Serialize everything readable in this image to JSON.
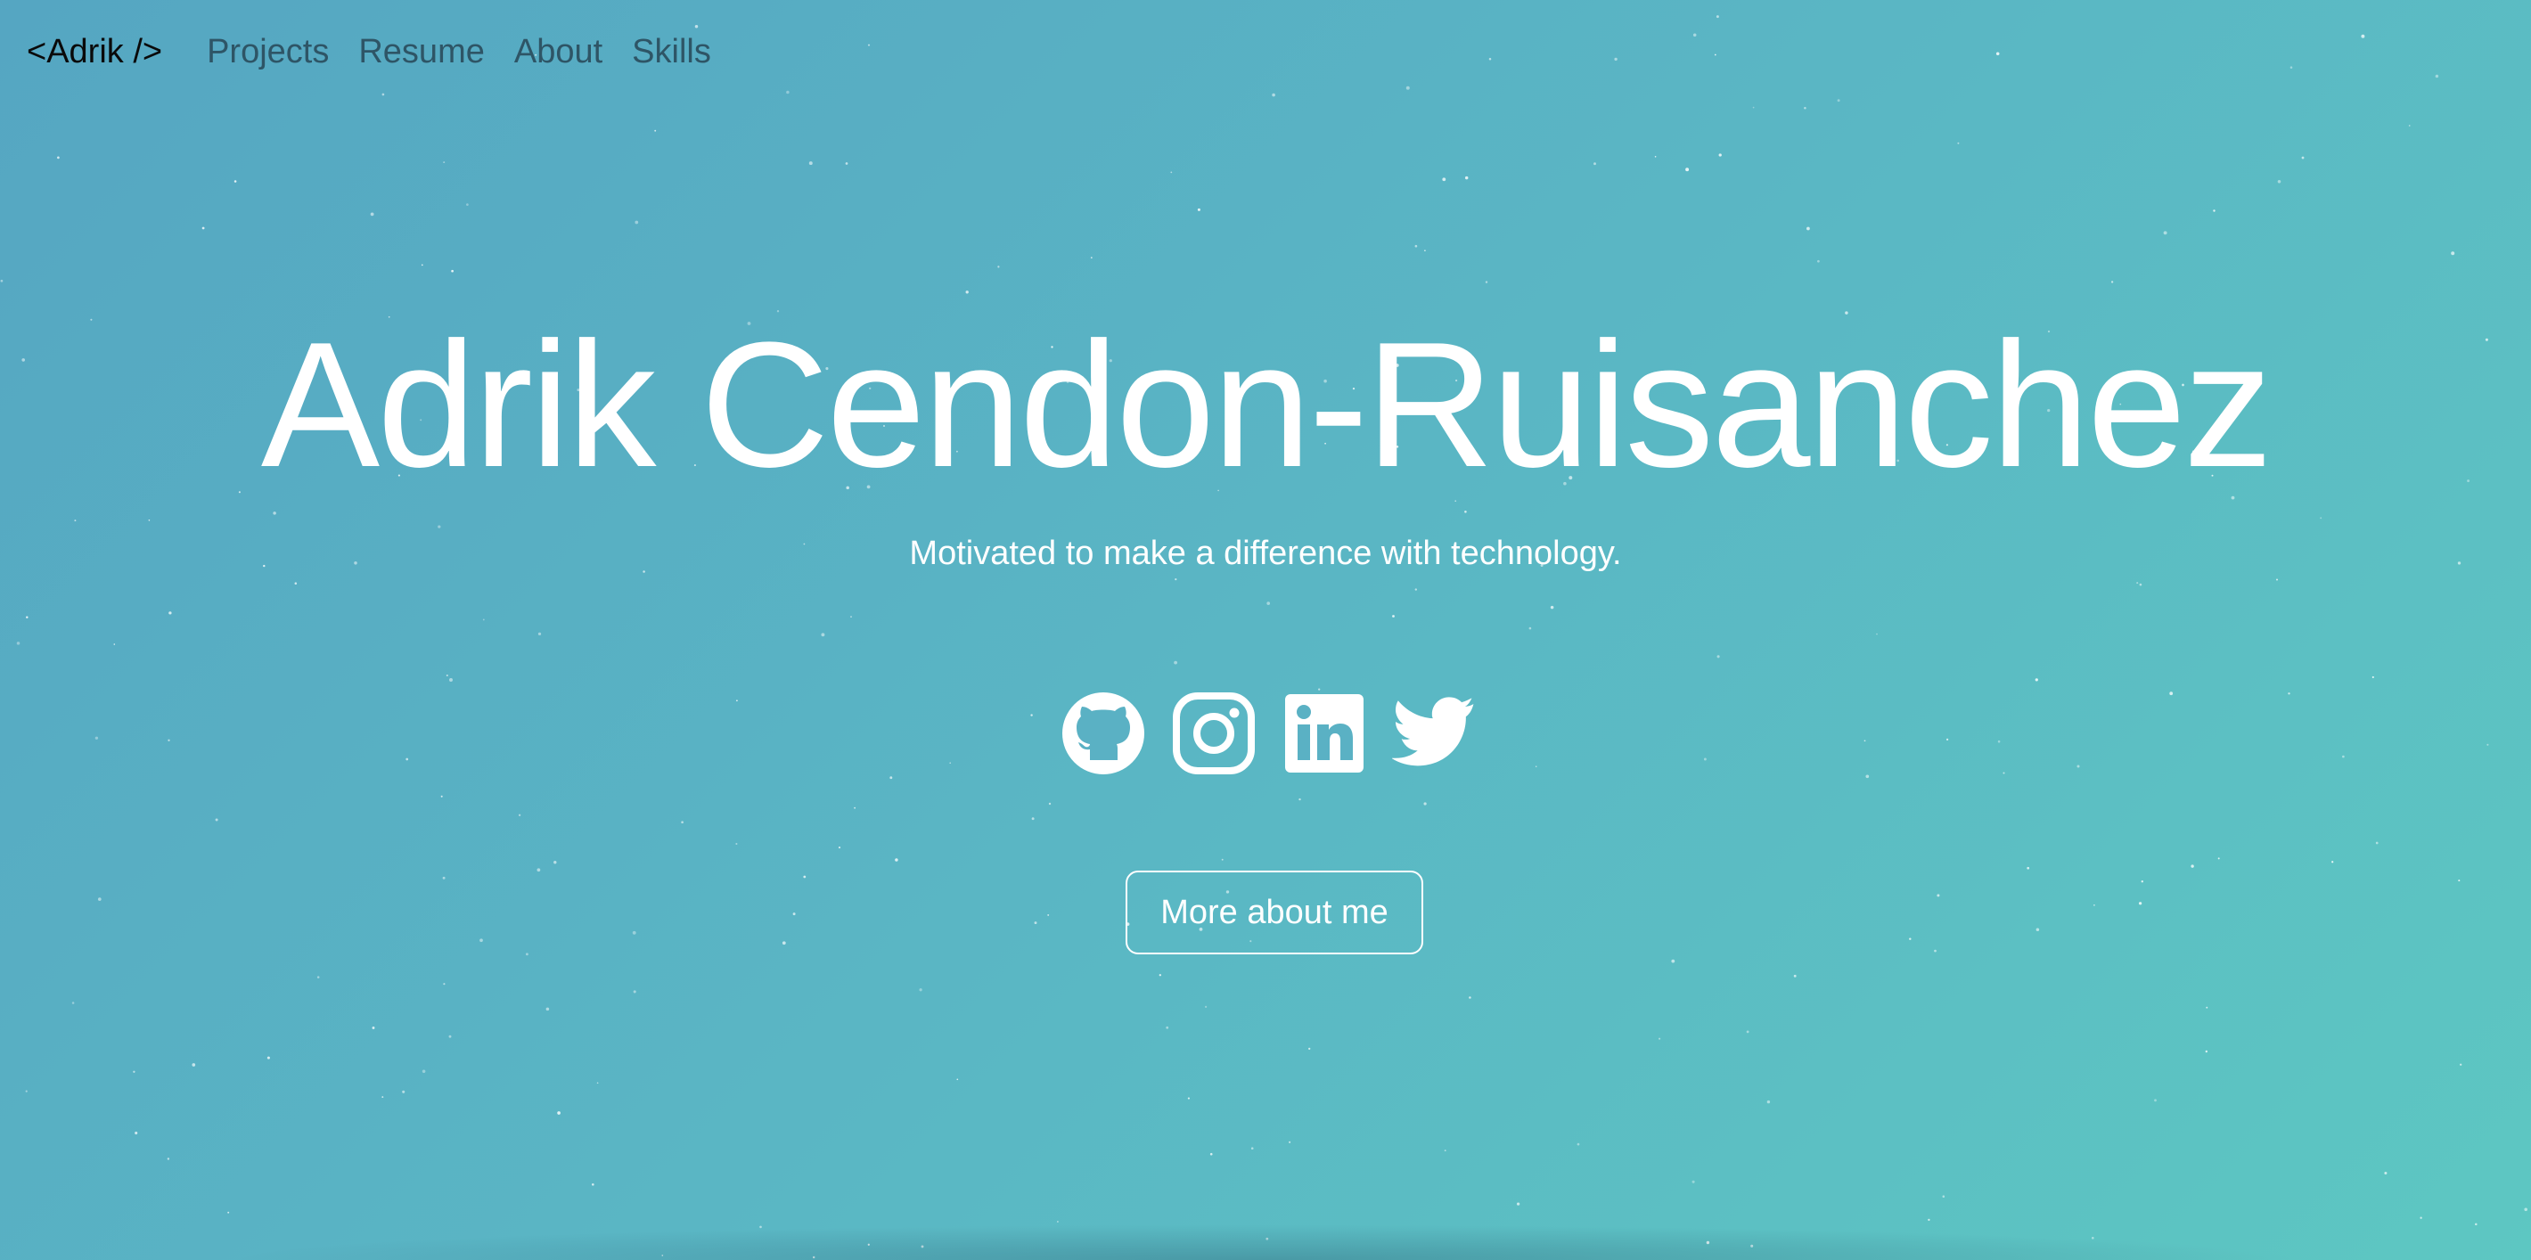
{
  "nav": {
    "brand": "<Adrik />",
    "links": [
      "Projects",
      "Resume",
      "About",
      "Skills"
    ]
  },
  "hero": {
    "name": "Adrik Cendon-Ruisanchez",
    "tagline": "Motivated to make a difference with technology.",
    "cta_label": "More about me"
  },
  "socials": [
    {
      "icon": "github-icon"
    },
    {
      "icon": "instagram-icon"
    },
    {
      "icon": "linkedin-icon"
    },
    {
      "icon": "twitter-icon"
    }
  ],
  "colors": {
    "background_start": "#55a6c2",
    "background_end": "#5dc7c2",
    "text_primary": "#ffffff",
    "nav_link": "#2e5566",
    "brand": "#0a0a0a"
  }
}
